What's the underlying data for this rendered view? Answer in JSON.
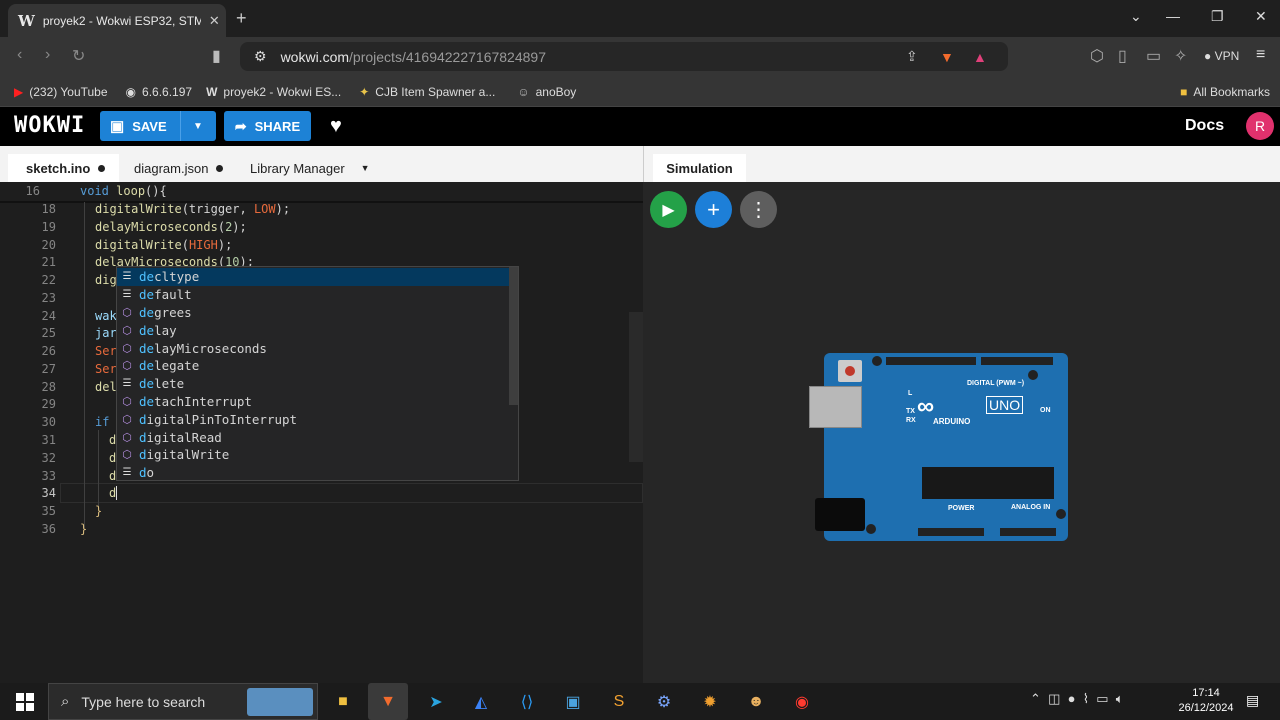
{
  "browser": {
    "tab_title": "proyek2 - Wokwi ESP32, STM3",
    "tab_favicon": "W",
    "url_host": "wokwi.com",
    "url_path": "/projects/416942227167824897",
    "vpn_label": "VPN",
    "bookmarks": [
      {
        "label": "(232) YouTube",
        "icon": "youtube-icon"
      },
      {
        "label": "6.6.6.197",
        "icon": "globe-icon"
      },
      {
        "label": "proyek2 - Wokwi ES...",
        "icon": "wokwi-icon"
      },
      {
        "label": "CJB Item Spawner a...",
        "icon": "game-icon"
      },
      {
        "label": "anoBoy",
        "icon": "anime-icon"
      }
    ],
    "all_bookmarks": "All Bookmarks"
  },
  "wokwi": {
    "logo": "WOKWI",
    "save_label": "SAVE",
    "share_label": "SHARE",
    "docs_label": "Docs",
    "avatar_letter": "R",
    "editor_tabs": {
      "sketch": "sketch.ino",
      "diagram": "diagram.json",
      "library": "Library Manager"
    },
    "sim_tab": "Simulation"
  },
  "code": {
    "sticky_line_no": "16",
    "sticky_line": "void loop(){",
    "lines": [
      {
        "no": "18",
        "text": "digitalWrite(trigger, LOW);"
      },
      {
        "no": "19",
        "text": "delayMicroseconds(2);"
      },
      {
        "no": "20",
        "text": "digitalWrite(HIGH);"
      },
      {
        "no": "21",
        "text": "delayMicroseconds(10);"
      },
      {
        "no": "22",
        "text": "dig"
      },
      {
        "no": "23",
        "text": ""
      },
      {
        "no": "24",
        "text": "wak"
      },
      {
        "no": "25",
        "text": "jar"
      },
      {
        "no": "26",
        "text": "Ser"
      },
      {
        "no": "27",
        "text": "Ser"
      },
      {
        "no": "28",
        "text": "del"
      },
      {
        "no": "29",
        "text": ""
      },
      {
        "no": "30",
        "text": "if"
      },
      {
        "no": "31",
        "text": "d"
      },
      {
        "no": "32",
        "text": "d"
      },
      {
        "no": "33",
        "text": "d"
      },
      {
        "no": "34",
        "text": "d"
      },
      {
        "no": "35",
        "text": "}"
      },
      {
        "no": "36",
        "text": "}"
      }
    ]
  },
  "autocomplete": [
    {
      "label": "decltype",
      "kind": "keyword"
    },
    {
      "label": "default",
      "kind": "keyword"
    },
    {
      "label": "degrees",
      "kind": "function"
    },
    {
      "label": "delay",
      "kind": "function"
    },
    {
      "label": "delayMicroseconds",
      "kind": "function"
    },
    {
      "label": "delegate",
      "kind": "function"
    },
    {
      "label": "delete",
      "kind": "keyword"
    },
    {
      "label": "detachInterrupt",
      "kind": "function"
    },
    {
      "label": "digitalPinToInterrupt",
      "kind": "function"
    },
    {
      "label": "digitalRead",
      "kind": "function"
    },
    {
      "label": "digitalWrite",
      "kind": "function"
    },
    {
      "label": "do",
      "kind": "keyword"
    }
  ],
  "board": {
    "uno": "UNO",
    "arduino": "ARDUINO",
    "digital": "DIGITAL (PWM ~)",
    "power": "POWER",
    "analog": "ANALOG IN",
    "on": "ON",
    "tx": "TX",
    "rx": "RX",
    "l": "L"
  },
  "taskbar": {
    "search_placeholder": "Type here to search",
    "time": "17:14",
    "date": "26/12/2024"
  },
  "colors": {
    "wokwi_blue": "#1d82d6",
    "play_green": "#24a148",
    "avatar_pink": "#e0316d"
  }
}
